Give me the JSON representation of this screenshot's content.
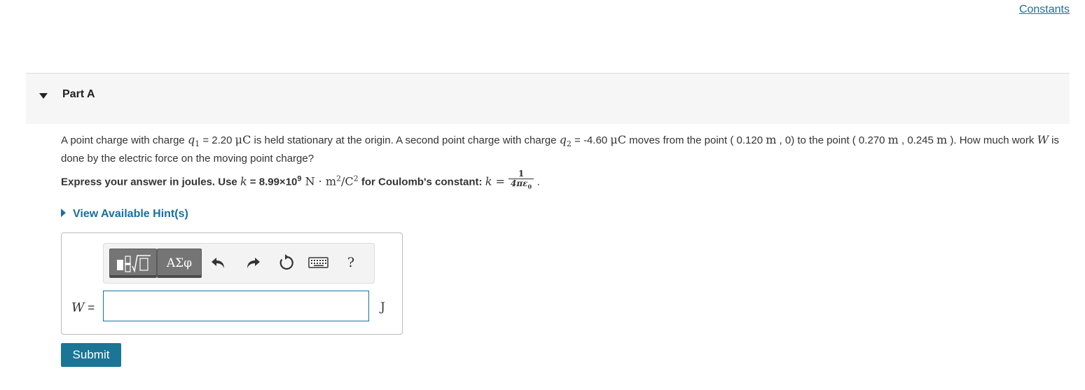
{
  "header": {
    "constants_link": "Constants"
  },
  "part": {
    "title": "Part A"
  },
  "question": {
    "t1": "A point charge with charge ",
    "q1_sym": "q",
    "q1_sub": "1",
    "t2": " = 2.20 ",
    "mu1": "μC",
    "t3": " is held stationary at the origin. A second point charge with charge ",
    "q2_sym": "q",
    "q2_sub": "2",
    "t4": " = -4.60 ",
    "mu2": "μC",
    "t5": " moves from the point ( 0.120 ",
    "m1": "m",
    "t6": " , 0) to the point ( 0.270 ",
    "m2": "m",
    "t7": " , 0.245 ",
    "m3": "m",
    "t8": " ). How much work ",
    "w_sym": "W",
    "t9": " is done by the electric force on the moving point charge?"
  },
  "instructions": {
    "t1": "Express your answer in joules. Use ",
    "k1": "k",
    "t2": " = 8.99×10",
    "exp9": "9",
    "units_main": " N · m",
    "sq1": "2",
    "units_mid": "/C",
    "sq2": "2",
    "t3": " for Coulomb's constant: ",
    "k2": "k",
    "eq": " = ",
    "frac_num": "1",
    "frac_den": "4πε",
    "frac_den_sub": "0",
    "t4": " ."
  },
  "hint": {
    "label": "View Available Hint(s)"
  },
  "toolbar": {
    "greek_label": "ΑΣφ",
    "help_label": "?",
    "icons": [
      "templates-icon",
      "greek-symbols-icon",
      "undo-icon",
      "redo-icon",
      "reset-icon",
      "keyboard-icon",
      "help-icon"
    ]
  },
  "answer": {
    "variable": "W",
    "equals": " =",
    "value": "",
    "placeholder": "",
    "unit": "J"
  },
  "submit": {
    "label": "Submit"
  },
  "colors": {
    "link": "#1a6fa0",
    "submit_bg": "#1a7596",
    "header_bg": "#f6f6f6",
    "toolbar_dark": "#757575"
  }
}
